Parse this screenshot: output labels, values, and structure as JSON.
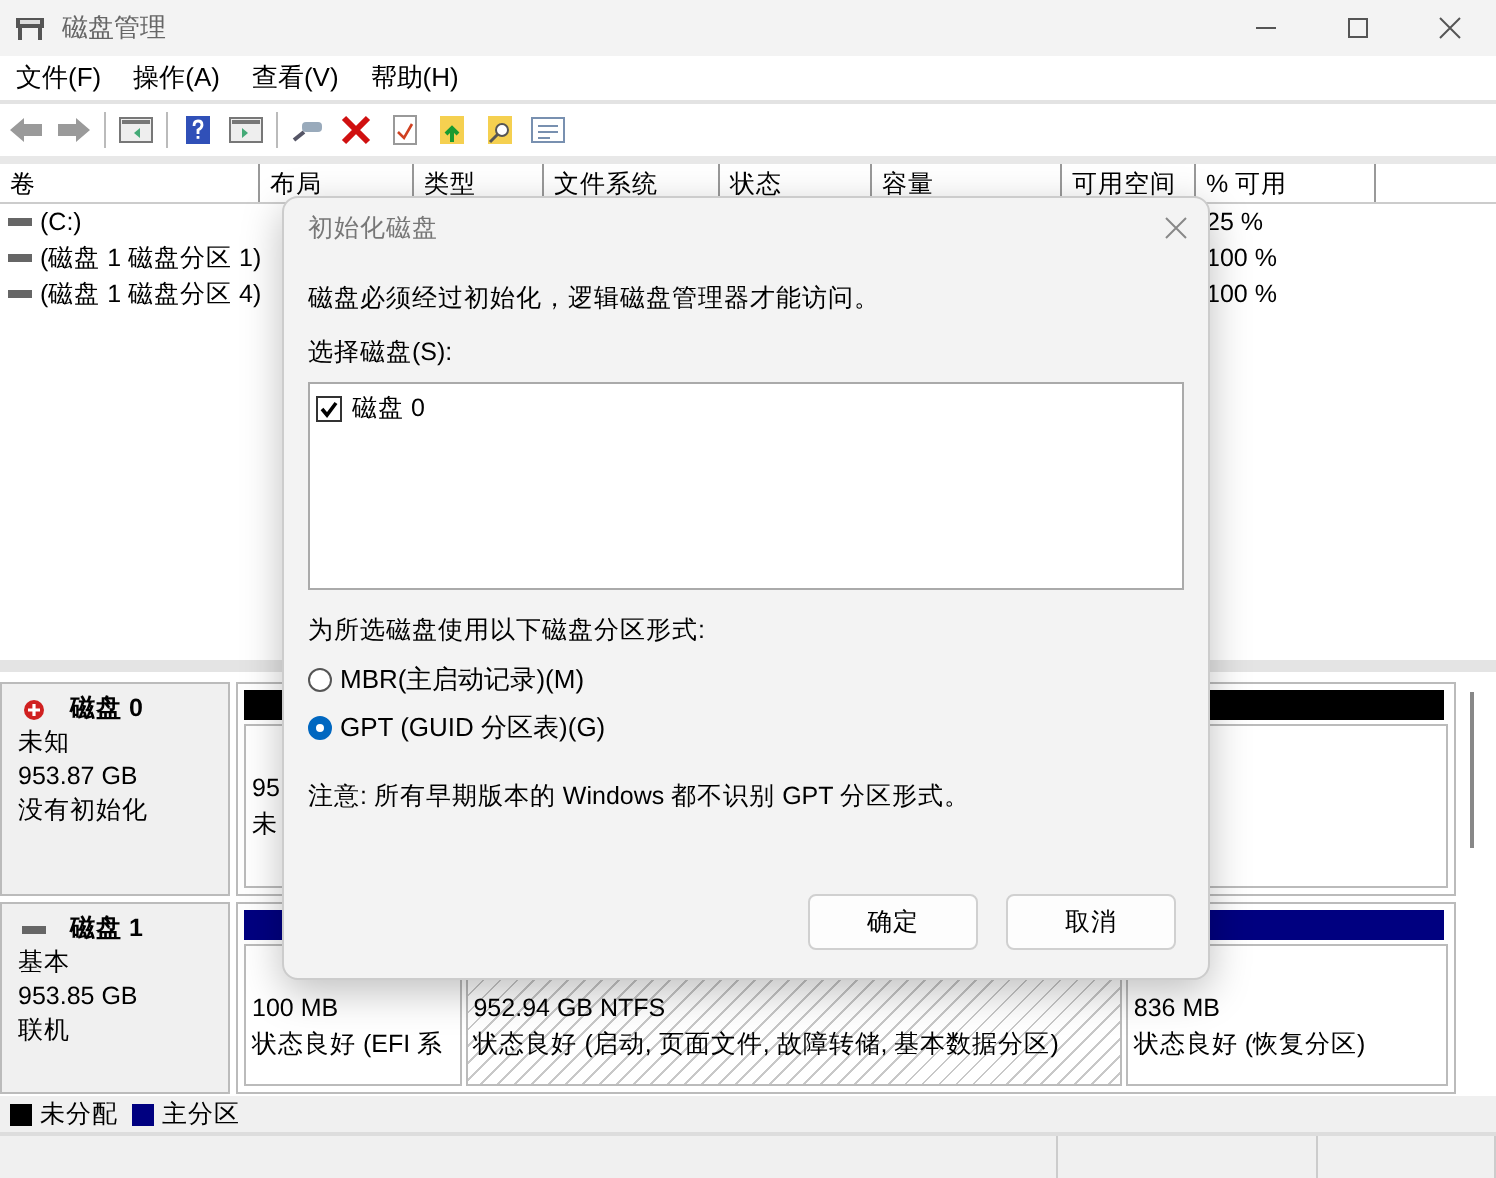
{
  "window": {
    "title": "磁盘管理"
  },
  "menu": [
    "文件(F)",
    "操作(A)",
    "查看(V)",
    "帮助(H)"
  ],
  "volume_list": {
    "columns": [
      "卷",
      "布局",
      "类型",
      "文件系统",
      "状态",
      "容量",
      "可用空间",
      "% 可用"
    ],
    "rows": [
      {
        "volume": "(C:)",
        "percent_free": "25 %"
      },
      {
        "volume": "(磁盘 1 磁盘分区 1)",
        "percent_free": "100 %"
      },
      {
        "volume": "(磁盘 1 磁盘分区 4)",
        "percent_free": "100 %"
      }
    ]
  },
  "disks": [
    {
      "kind": "uninitialized",
      "name": "磁盘 0",
      "type": "未知",
      "size": "953.87 GB",
      "status": "没有初始化",
      "partitions": [
        {
          "kind": "unallocated",
          "selected": false,
          "size": "95",
          "status": "未"
        }
      ]
    },
    {
      "kind": "basic",
      "name": "磁盘 1",
      "type": "基本",
      "size": "953.85 GB",
      "status": "联机",
      "partitions": [
        {
          "kind": "primary",
          "selected": false,
          "size": "100 MB",
          "status": "状态良好 (EFI 系"
        },
        {
          "kind": "primary",
          "selected": true,
          "size": "952.94 GB NTFS",
          "status": "状态良好 (启动, 页面文件, 故障转储, 基本数据分区)"
        },
        {
          "kind": "primary",
          "selected": false,
          "size": "836 MB",
          "status": "状态良好 (恢复分区)"
        }
      ]
    }
  ],
  "legend": [
    {
      "label": "未分配",
      "color": "#000000"
    },
    {
      "label": "主分区",
      "color": "#000080"
    }
  ],
  "dialog": {
    "title": "初始化磁盘",
    "message": "磁盘必须经过初始化，逻辑磁盘管理器才能访问。",
    "select_label": "选择磁盘(S):",
    "disks": [
      {
        "label": "磁盘 0",
        "checked": true
      }
    ],
    "style_label": "为所选磁盘使用以下磁盘分区形式:",
    "options": [
      {
        "label": "MBR(主启动记录)(M)",
        "selected": false
      },
      {
        "label": "GPT (GUID 分区表)(G)",
        "selected": true
      }
    ],
    "note": "注意: 所有早期版本的 Windows 都不识别 GPT 分区形式。",
    "buttons": [
      "确定",
      "取消"
    ]
  }
}
